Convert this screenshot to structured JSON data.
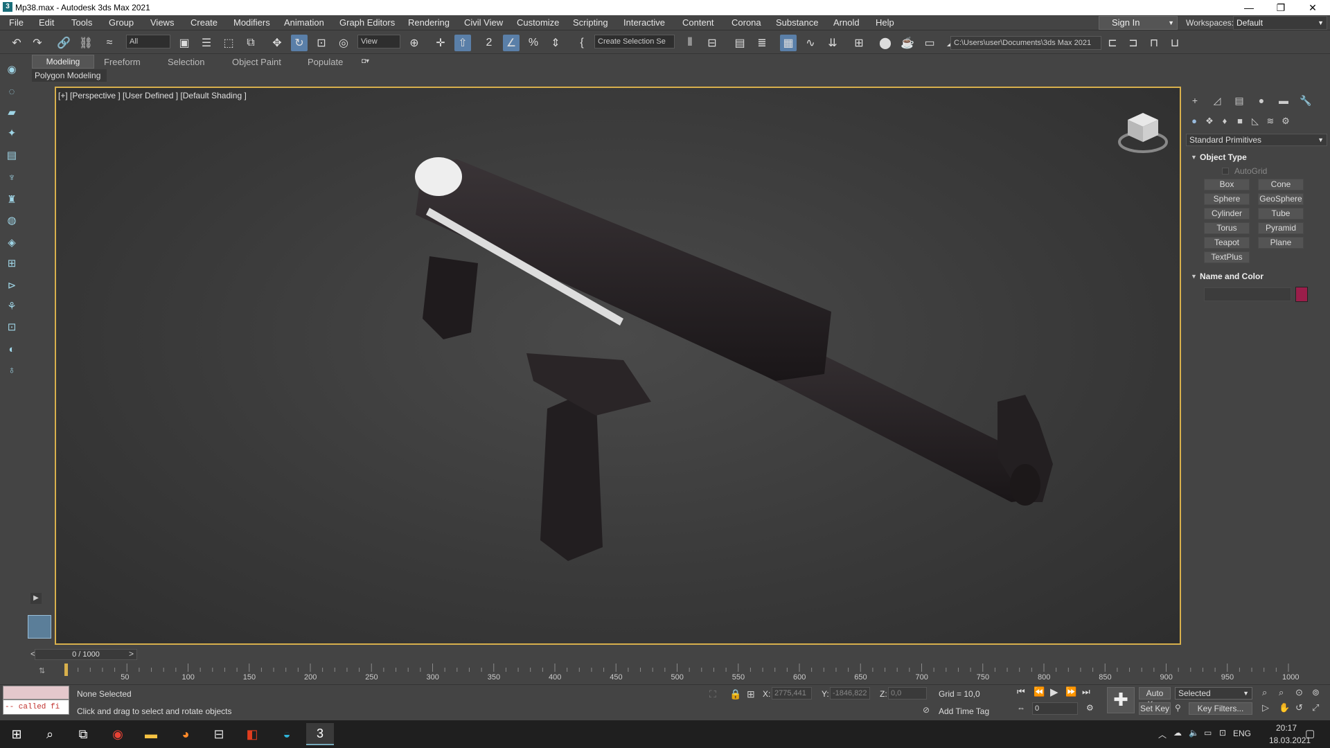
{
  "window": {
    "title": "Mp38.max - Autodesk 3ds Max 2021",
    "minimize": "—",
    "maximize": "❐",
    "close": "✕"
  },
  "menu": [
    "File",
    "Edit",
    "Tools",
    "Group",
    "Views",
    "Create",
    "Modifiers",
    "Animation",
    "Graph Editors",
    "Rendering",
    "Civil View",
    "Customize",
    "Scripting",
    "Interactive",
    "Content",
    "Corona",
    "Substance",
    "Arnold",
    "Help"
  ],
  "account": {
    "sign_in": "Sign In",
    "workspaces_label": "Workspaces:",
    "workspace": "Default"
  },
  "toolbar": {
    "selection_filter": "All",
    "ref_coord": "View",
    "selection_set": "Create Selection Se",
    "project_path": "C:\\Users\\user\\Documents\\3ds Max 2021"
  },
  "ribbon": {
    "tabs": [
      "Modeling",
      "Freeform",
      "Selection",
      "Object Paint",
      "Populate"
    ],
    "active_panel": "Polygon Modeling"
  },
  "viewport": {
    "label": "[+] [Perspective ] [User Defined ] [Default Shading ]"
  },
  "command_panel": {
    "category": "Standard Primitives",
    "object_type_header": "Object Type",
    "autogrid": "AutoGrid",
    "buttons": [
      "Box",
      "Cone",
      "Sphere",
      "GeoSphere",
      "Cylinder",
      "Tube",
      "Torus",
      "Pyramid",
      "Teapot",
      "Plane",
      "TextPlus"
    ],
    "name_color_header": "Name and Color",
    "object_color": "#9a1e4a"
  },
  "timeline": {
    "frame": "0 / 1000",
    "prev": "<",
    "next": ">",
    "ticks": [
      "50",
      "100",
      "150",
      "200",
      "250",
      "300",
      "350",
      "400",
      "450",
      "500",
      "550",
      "600",
      "650",
      "700",
      "750",
      "800",
      "850",
      "900",
      "950",
      "1000"
    ]
  },
  "status": {
    "maxscript_out": "-- called fi",
    "selection": "None Selected",
    "prompt": "Click and drag to select and rotate objects",
    "x_label": "X:",
    "x_value": "2775,441",
    "y_label": "Y:",
    "y_value": "-1846,822",
    "z_label": "Z:",
    "z_value": "0,0",
    "grid": "Grid = 10,0",
    "add_time_tag": "Add Time Tag",
    "auto_key": "Auto Key",
    "set_key": "Set Key",
    "key_mode": "Selected",
    "key_filters": "Key Filters...",
    "current_frame": "0"
  },
  "taskbar": {
    "lang": "ENG",
    "time": "20:17",
    "date": "18.03.2021"
  }
}
